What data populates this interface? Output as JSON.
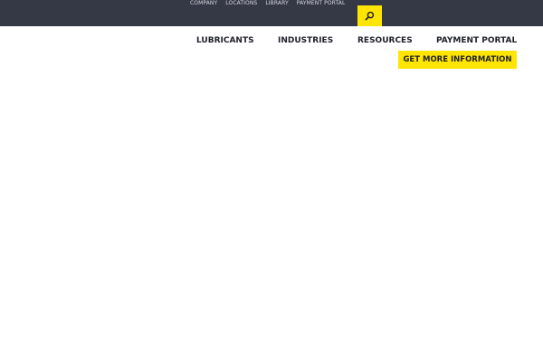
{
  "utility_nav": {
    "items": [
      {
        "label": "COMPANY"
      },
      {
        "label": "LOCATIONS"
      },
      {
        "label": "LIBRARY"
      },
      {
        "label": "PAYMENT PORTAL"
      }
    ]
  },
  "search": {
    "icon": "search-icon"
  },
  "main_nav": {
    "items": [
      {
        "label": "LUBRICANTS"
      },
      {
        "label": "INDUSTRIES"
      },
      {
        "label": "RESOURCES"
      },
      {
        "label": "PAYMENT PORTAL"
      }
    ]
  },
  "cta": {
    "label": "GET MORE INFORMATION"
  },
  "colors": {
    "header_bg": "#353845",
    "accent": "#ffe500",
    "nav_text": "#1e2029",
    "utility_text": "#d8dae0"
  }
}
